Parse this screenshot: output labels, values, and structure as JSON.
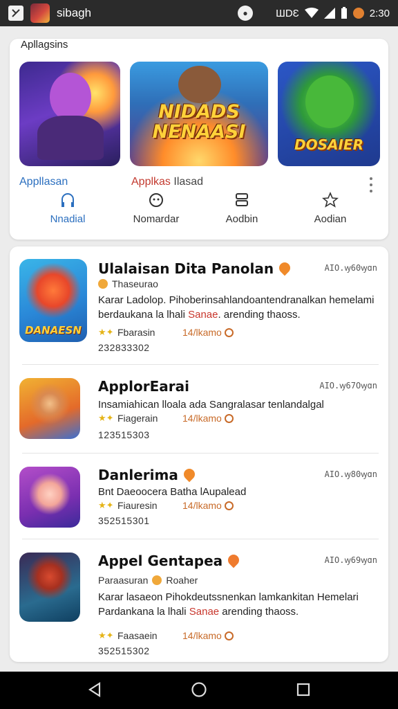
{
  "status_bar": {
    "title": "sibagh",
    "network": "ШDƐ",
    "time": "2:30"
  },
  "top_card": {
    "title": "Apllagsins",
    "tiles": [
      {
        "label": "",
        "art_text": ""
      },
      {
        "label": "",
        "art_text": "NIDADS NENAASI"
      },
      {
        "label": "",
        "art_text": "DOSAIER"
      }
    ],
    "tile_labels": {
      "first": "Appllasan",
      "second_red": "Applkas",
      "second_rest": " Ilasad"
    },
    "nav": [
      {
        "label": "Nnadial",
        "icon": "headphones-icon",
        "active": true
      },
      {
        "label": "Nomardar",
        "icon": "badge-icon",
        "active": false
      },
      {
        "label": "Aodbin",
        "icon": "stack-icon",
        "active": false
      },
      {
        "label": "Aodian",
        "icon": "star-outline-icon",
        "active": false
      }
    ]
  },
  "apps": [
    {
      "name": "Ulalaisan Dita Panolan",
      "version": "AIO.ꝡ60ꝡɑn",
      "publisher": "Thaseurao",
      "desc_plain": "Karar Ladolop. Pihoberinsahlandoantendranalkan hemelami berdaukana la lhali ",
      "desc_highlight": "Sanae",
      "desc_tail": ". arending thaoss.",
      "icon_text": "DANAESN",
      "rating_label": "Fbarasin",
      "downloads": "14/lkamo",
      "count": "232833302"
    },
    {
      "name": "ApplorEarai",
      "version": "AIO.ꝡ67Oꝡɑn",
      "publisher": "",
      "desc_plain": "Insamiahican lloala ada Sangralasar tenlandalgal",
      "desc_highlight": "",
      "desc_tail": "",
      "icon_text": "",
      "rating_label": "Fiagerain",
      "downloads": "14/lkamo",
      "count": "123515303"
    },
    {
      "name": "Danlerima",
      "version": "AIO.ꝡ80ꝡɑn",
      "publisher": "",
      "desc_plain": "Bnt Daeoocera Batha lAupalead",
      "desc_highlight": "",
      "desc_tail": "",
      "icon_text": "",
      "rating_label": "Fiauresin",
      "downloads": "14/lkamo",
      "count": "352515301"
    },
    {
      "name": "Appel Gentapea",
      "version": "AIO.ꝡ69ꝡɑn",
      "publisher_a": "Paraasuran",
      "publisher_b": "Roaher",
      "desc_plain": "Karar lasaeon Pihokdeutssnenkan lamkankitan Hemelari Pardankana la lhali ",
      "desc_highlight": "Sanae",
      "desc_tail": " arending thaoss.",
      "icon_text": "",
      "rating_label": "Faasaein",
      "downloads": "14/lkamo",
      "count": "352515302"
    }
  ],
  "colors": {
    "accent_blue": "#2b6fbf",
    "highlight_red": "#c8362c",
    "downloads_orange": "#c86a28",
    "star_yellow": "#e5b418"
  }
}
